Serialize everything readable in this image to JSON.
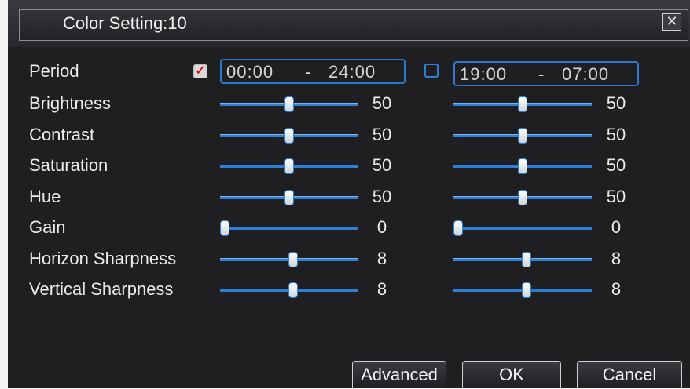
{
  "window": {
    "title": "Color Setting:10",
    "close_symbol": "✕"
  },
  "period": {
    "label": "Period",
    "period1": {
      "checked": true,
      "check_mark": "✓",
      "start": "00:00",
      "separator": "-",
      "end": "24:00"
    },
    "period2": {
      "checked": false,
      "start": "19:00",
      "separator": "-",
      "end": "07:00"
    }
  },
  "settings": [
    {
      "label": "Brightness",
      "max": 100,
      "p1": 50,
      "p2": 50
    },
    {
      "label": "Contrast",
      "max": 100,
      "p1": 50,
      "p2": 50
    },
    {
      "label": "Saturation",
      "max": 100,
      "p1": 50,
      "p2": 50
    },
    {
      "label": "Hue",
      "max": 100,
      "p1": 50,
      "p2": 50
    },
    {
      "label": "Gain",
      "max": 100,
      "p1": 0,
      "p2": 0
    },
    {
      "label": "Horizon Sharpness",
      "max": 15,
      "p1": 8,
      "p2": 8
    },
    {
      "label": "Vertical Sharpness",
      "max": 15,
      "p1": 8,
      "p2": 8
    }
  ],
  "buttons": {
    "advanced": "Advanced",
    "ok": "OK",
    "cancel": "Cancel"
  },
  "colors": {
    "accent": "#2c7fd6",
    "background": "#1f1f21",
    "text": "#ececec",
    "check_mark": "#e01515"
  }
}
